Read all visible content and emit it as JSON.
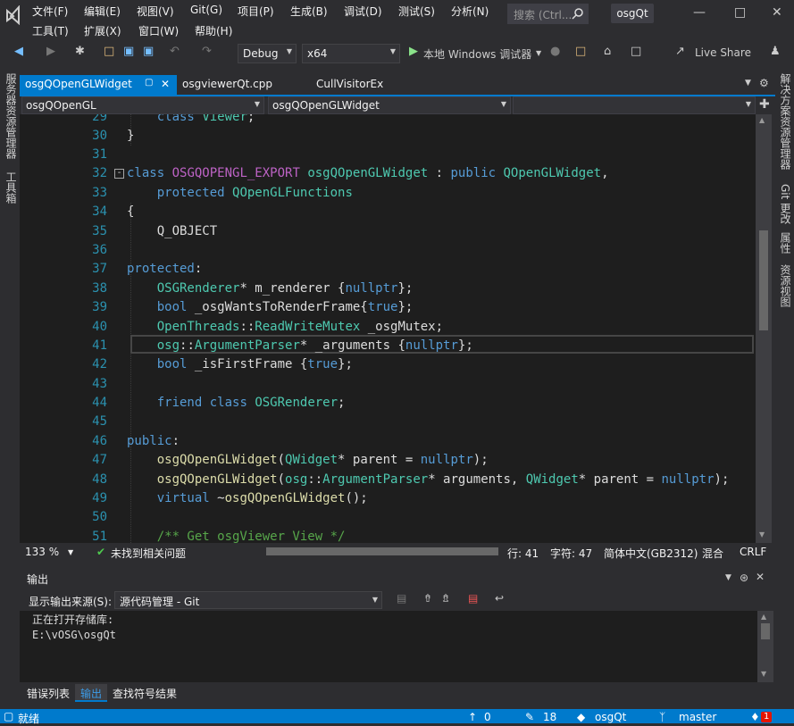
{
  "menu": {
    "items": [
      "文件(F)",
      "编辑(E)",
      "视图(V)",
      "Git(G)",
      "项目(P)",
      "生成(B)",
      "调试(D)",
      "测试(S)",
      "分析(N)"
    ],
    "items2": [
      "工具(T)",
      "扩展(X)",
      "窗口(W)",
      "帮助(H)"
    ],
    "search_placeholder": "搜索 (Ctrl...",
    "app_title": "osgQt"
  },
  "toolbar": {
    "config": "Debug",
    "platform": "x64",
    "run_label": "本地 Windows 调试器",
    "live_share": "Live Share"
  },
  "rails": {
    "left1": "服务器资源管理器",
    "left2": "工具箱",
    "right1": "解决方案资源管理器",
    "right2": "Git 更改",
    "right3": "属性",
    "right4": "资源视图"
  },
  "tabs": [
    {
      "label": "osgQOpenGLWidget"
    },
    {
      "label": "osgviewerQt.cpp"
    },
    {
      "label": "CullVisitorEx"
    }
  ],
  "navbar": {
    "scope": "osgQOpenGL",
    "member": "osgQOpenGLWidget"
  },
  "editor": {
    "line_numbers": [
      "29",
      "30",
      "31",
      "32",
      "33",
      "34",
      "35",
      "36",
      "37",
      "38",
      "39",
      "40",
      "41",
      "42",
      "43",
      "44",
      "45",
      "46",
      "47",
      "48",
      "49",
      "50",
      "51"
    ]
  },
  "status_editor": {
    "zoom": "133 %",
    "issues": "未找到相关问题",
    "line": "行: 41",
    "char": "字符: 47",
    "encoding": "简体中文(GB2312)",
    "whitespace": "混合",
    "eol": "CRLF"
  },
  "output": {
    "title": "输出",
    "source_label": "显示输出来源(S):",
    "source_value": "源代码管理 - Git",
    "lines": [
      "正在打开存储库:",
      "E:\\vOSG\\osgQt"
    ]
  },
  "bottom_tabs": [
    "错误列表",
    "输出",
    "查找符号结果"
  ],
  "statusbar": {
    "ready": "就绪",
    "up": "0",
    "edits": "18",
    "repo": "osgQt",
    "branch": "master",
    "notif": "1"
  },
  "colors": {
    "accent": "#007acc",
    "keyword": "#569cd6",
    "type": "#4ec9b0",
    "comment": "#57a64a",
    "macro": "#bd63c5",
    "function": "#dcdcaa"
  }
}
